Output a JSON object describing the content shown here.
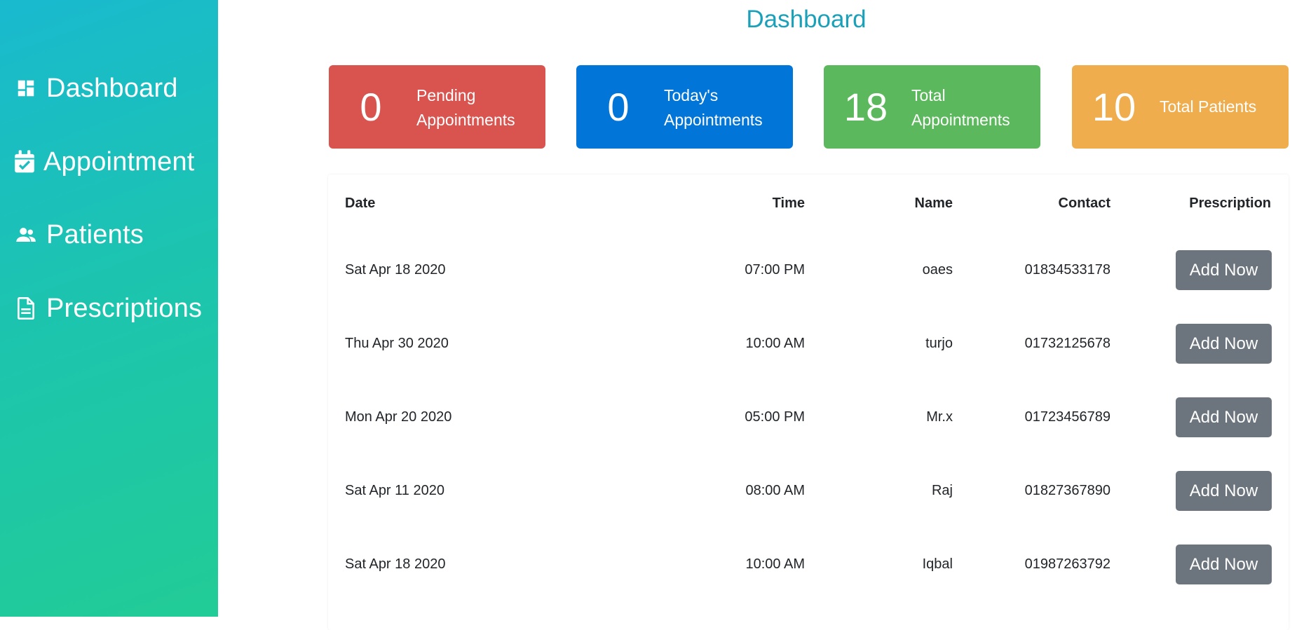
{
  "sidebar": {
    "items": [
      {
        "label": "Dashboard",
        "icon": "dashboard-icon"
      },
      {
        "label": "Appointment",
        "icon": "calendar-check-icon"
      },
      {
        "label": "Patients",
        "icon": "users-icon"
      },
      {
        "label": "Prescriptions",
        "icon": "document-icon"
      }
    ]
  },
  "main": {
    "title": "Dashboard"
  },
  "cards": [
    {
      "value": "0",
      "line1": "Pending",
      "line2": "Appointments",
      "color": "#d9534f"
    },
    {
      "value": "0",
      "line1": "Today's",
      "line2": "Appointments",
      "color": "#0275d8"
    },
    {
      "value": "18",
      "line1": "Total",
      "line2": "Appointments",
      "color": "#5cb85c"
    },
    {
      "value": "10",
      "line1": "Total Patients",
      "line2": "",
      "color": "#f0ad4e"
    }
  ],
  "table": {
    "headers": [
      "Date",
      "Time",
      "Name",
      "Contact",
      "Prescription"
    ],
    "rows": [
      {
        "date": "Sat Apr 18 2020",
        "time": "07:00 PM",
        "name": "oaes",
        "contact": "01834533178",
        "action": "Add Now"
      },
      {
        "date": "Thu Apr 30 2020",
        "time": "10:00 AM",
        "name": "turjo",
        "contact": "01732125678",
        "action": "Add Now"
      },
      {
        "date": "Mon Apr 20 2020",
        "time": "05:00 PM",
        "name": "Mr.x",
        "contact": "01723456789",
        "action": "Add Now"
      },
      {
        "date": "Sat Apr 11 2020",
        "time": "08:00 AM",
        "name": "Raj",
        "contact": "01827367890",
        "action": "Add Now"
      },
      {
        "date": "Sat Apr 18 2020",
        "time": "10:00 AM",
        "name": "Iqbal",
        "contact": "01987263792",
        "action": "Add Now"
      }
    ]
  }
}
